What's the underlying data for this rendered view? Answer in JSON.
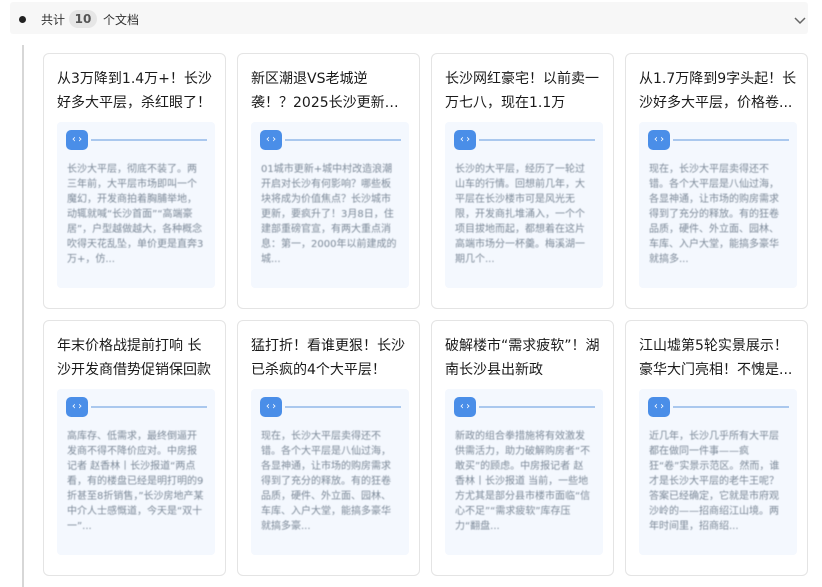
{
  "header": {
    "prefix": "共计",
    "count": "10",
    "suffix": "个文档"
  },
  "cards": [
    {
      "title": "从3万降到1.4万+！长沙好多大平层，杀红眼了！",
      "preview": "长沙大平层，彻底不装了。两三年前，大平层市场即叫一个魔幻，开发商拍着胸脯举地，动辄就喊“长沙首面”“高端豪居”，户型越做越大，各种概念吹得天花乱坠，单价更是直奔3万+，仿..."
    },
    {
      "title": "新区潮退VS老城逆袭！？2025长沙更新爆发，市...",
      "preview": "01城市更新+城中村改造浪潮开启对长沙有何影响？哪些板块将成为价值焦点？长沙城市更新，要疯升了！3月8日，住建部重磅官宣，有两大重点消息：第一，2000年以前建成的城..."
    },
    {
      "title": "长沙网红豪宅！以前卖一万七八，现在1.1万+起！",
      "preview": "长沙的大平层，经历了一轮过山车的行情。回想前几年，大平层在长沙楼市可是风光无限，开发商扎堆涌入，一个个项目拔地而起，都想着在这片高端市场分一杯羹。梅溪湖一期几个..."
    },
    {
      "title": "从1.7万降到9字头起！长沙好多大平层，价格卷...",
      "preview": "现在，长沙大平层卖得还不错。各个大平层是八仙过海，各显神通，让市场的购房需求得到了充分的释放。有的狂卷品质，硬件、外立面、园林、车库、入户大堂，能搞多豪华就搞多..."
    },
    {
      "title": "年末价格战提前打响 长沙开发商借势促销保回款",
      "preview": "高库存、低需求，最终倒逼开发商不得不降价应对。中房报记者 赵香林丨长沙报道“两点看，有的楼盘已经是明打明的9折甚至8折销售，”长沙房地产某中介人士感慨道，今天是“双十一”..."
    },
    {
      "title": "猛打折！看谁更狠！长沙已杀疯的4个大平层！",
      "preview": "现在，长沙大平层卖得还不错。各个大平层是八仙过海，各显神通，让市场的购房需求得到了充分的释放。有的狂卷品质，硬件、外立面、园林、车库、入户大堂，能搞多豪华就搞多豪..."
    },
    {
      "title": "破解楼市“需求疲软”！湖南长沙县出新政",
      "preview": "新政的组合拳措施将有效激发供需活力，助力破解购房者“不敢买”的顾虑。中房报记者 赵香林丨长沙报道 当前，一些地方尤其是部分县市楼市面临“信心不足”“需求疲软”库存压力“翻盘..."
    },
    {
      "title": "江山墟第5轮实景展示！豪华大门亮相！不愧是...",
      "preview": "近几年，长沙几乎所有大平层都在做同一件事——疯狂“卷”实景示范区。然而，谁才是长沙大平层的老牛王呢？答案已经确定，它就是市府观沙岭的——招商绍江山境。两年时间里，招商绍..."
    }
  ]
}
